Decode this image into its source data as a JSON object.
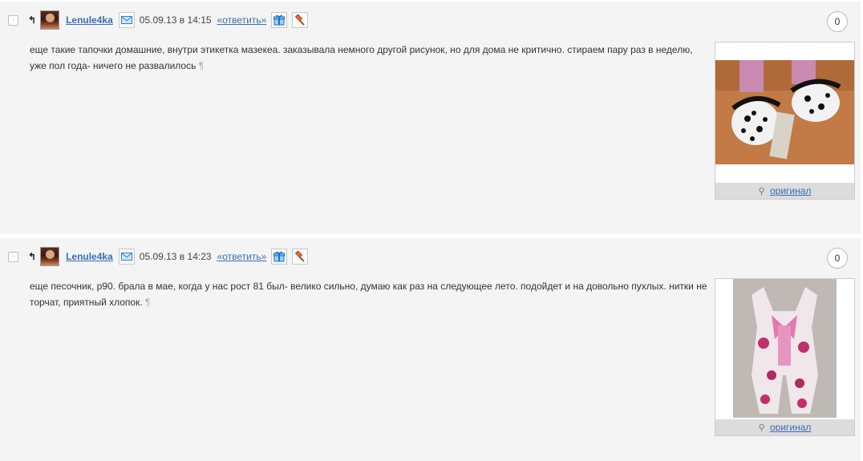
{
  "comments": [
    {
      "author": "Lenule4ka",
      "date": "05.09.13 в 14:15",
      "reply_label": "«ответить»",
      "count": "0",
      "text": "еще такие тапочки домашние, внутри этикетка мазекеа. заказывала немного другой рисунок, но для дома не критично. стираем пару раз в неделю, уже пол года- ничего не развалилось",
      "pilcrow": "¶",
      "original_label": "оригинал"
    },
    {
      "author": "Lenule4ka",
      "date": "05.09.13 в 14:23",
      "reply_label": "«ответить»",
      "count": "0",
      "text": "еще песочник, р90. брала в мае, когда у нас рост 81 был- велико сильно, думаю как раз на следующее лето. подойдет и на довольно пухлых. нитки не торчат, приятный хлопок.",
      "pilcrow": "¶",
      "original_label": "оригинал"
    }
  ],
  "icons": {
    "collapse": "·",
    "parent": "↰",
    "magnifier": "⚲"
  },
  "colors": {
    "link": "#3a6cb4",
    "background": "#f4f4f4"
  }
}
